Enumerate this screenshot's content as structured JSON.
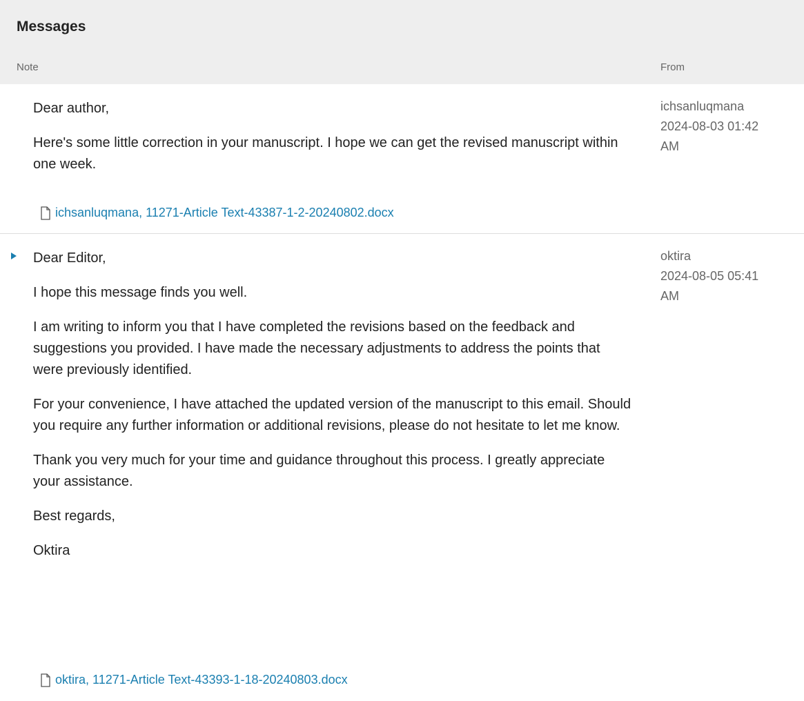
{
  "panel": {
    "title": "Messages",
    "columns": {
      "note": "Note",
      "from": "From"
    }
  },
  "messages": [
    {
      "paragraphs": [
        "Dear author,",
        "Here's some little correction in your manuscript. I hope we can get the revised manuscript within one week."
      ],
      "attachment": "ichsanluqmana, 11271-Article Text-43387-1-2-20240802.docx",
      "author": "ichsanluqmana",
      "date": "2024-08-03 01:42 AM"
    },
    {
      "paragraphs": [
        "Dear Editor,",
        "I hope this message finds you well.",
        "I am writing to inform you that I have completed the revisions based on the feedback and suggestions you provided. I have made the necessary adjustments to address the points that were previously identified.",
        "For your convenience, I have attached the updated version of the manuscript to this email. Should you require any further information or additional revisions, please do not hesitate to let me know.",
        "Thank you very much for your time and guidance throughout this process. I greatly appreciate your assistance.",
        "Best regards,",
        "Oktira"
      ],
      "attachment": "oktira, 11271-Article Text-43393-1-18-20240803.docx",
      "author": "oktira",
      "date": "2024-08-05 05:41 AM"
    }
  ],
  "icons": {
    "attachment": "file-icon",
    "toggle": "triangle-right-icon"
  },
  "colors": {
    "header_bg": "#eeeeee",
    "link": "#1a7fb0",
    "meta_text": "#666666",
    "body_text": "#222222"
  }
}
